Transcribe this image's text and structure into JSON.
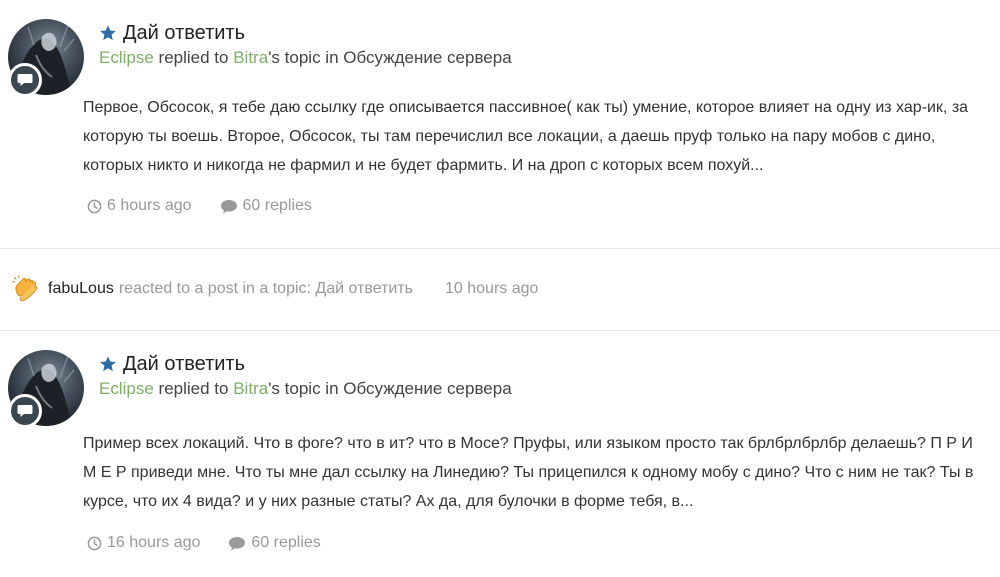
{
  "posts": [
    {
      "title": "Дай ответить",
      "author": "Eclipse",
      "verb": "replied to",
      "target_user": "Bitra",
      "possessive": "'s topic in",
      "forum": "Обсуждение сервера",
      "snippet": "Первое, Обсосок, я тебе даю ссылку где описывается пассивное( как ты) умение, которое влияет на одну из хар-ик, за которую ты воешь. Второе, Обсосок, ты там перечислил все локации, а даешь пруф только на пару мобов с дино, которых никто и никогда не фармил и не будет фармить. И на дроп с которых всем похуй...",
      "time": "6 hours ago",
      "replies": "60 replies"
    },
    {
      "title": "Дай ответить",
      "author": "Eclipse",
      "verb": "replied to",
      "target_user": "Bitra",
      "possessive": "'s topic in",
      "forum": "Обсуждение сервера",
      "snippet": "Пример всех локаций. Что в фоге? что в ит? что в Мосе? Пруфы, или языком просто так брлбрлбрлбр делаешь? П Р И М Е Р приведи мне. Что ты мне дал ссылку на Линедию? Ты прицепился к одному мобу с дино? Что с ним не так? Ты в курсе, что их 4 вида? и у них разные статы? Ах да, для булочки в форме тебя, в...",
      "time": "16 hours ago",
      "replies": "60 replies"
    }
  ],
  "reaction": {
    "user": "fabuLous",
    "text": "reacted to a post in a topic: Дай ответить",
    "time": "10 hours ago"
  },
  "colors": {
    "user_link": "#7fae6a",
    "star": "#2e6aa6",
    "muted": "#999999",
    "badge": "#3a4650"
  },
  "icons": [
    "star-icon",
    "chat-bubble-icon",
    "clock-icon",
    "comment-icon",
    "clapping-hands-icon"
  ]
}
